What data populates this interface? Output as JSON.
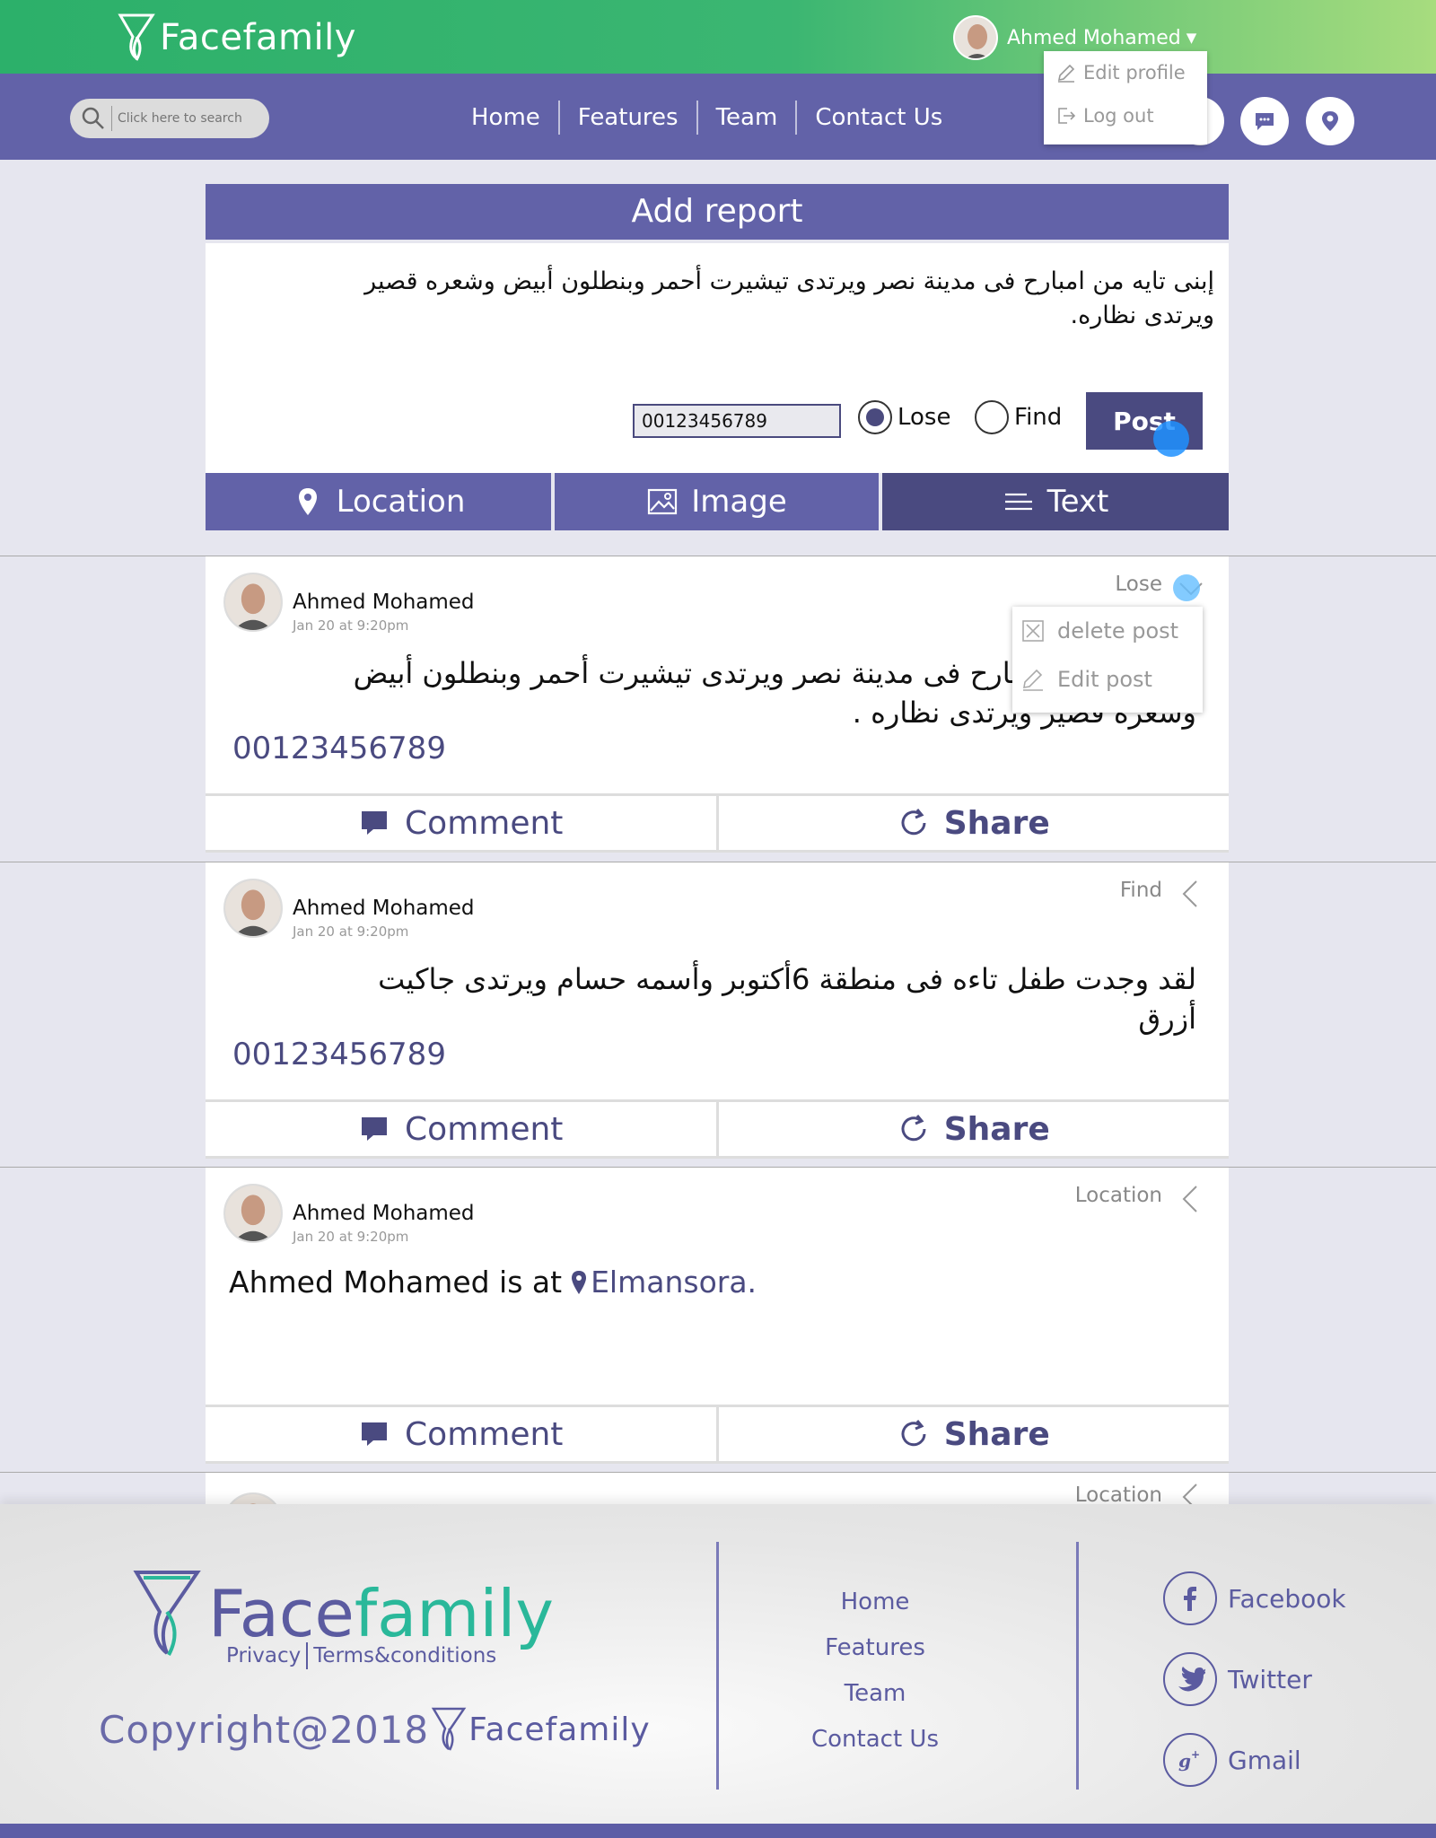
{
  "brand": {
    "name_part1": "Face",
    "name_part2": "family"
  },
  "user": {
    "name": "Ahmed Mohamed"
  },
  "user_dropdown": {
    "items": [
      {
        "label": "Edit profile",
        "icon": "pencil-icon"
      },
      {
        "label": "Log out",
        "icon": "logout-icon"
      }
    ]
  },
  "search": {
    "placeholder": "Click here to search"
  },
  "nav": {
    "links": [
      "Home",
      "Features",
      "Team",
      "Contact Us"
    ]
  },
  "report": {
    "title": "Add report",
    "text": "إبنى تايه من امبارح فى مدينة نصر ويرتدى تيشيرت أحمر وبنطلون أبيض وشعره قصير ويرتدى نظاره.",
    "phone": "00123456789",
    "option_lose": "Lose",
    "option_find": "Find",
    "selected": "Lose",
    "post_label": "Post",
    "tabs": [
      {
        "label": "Location",
        "icon": "map-pin-icon"
      },
      {
        "label": "Image",
        "icon": "image-icon"
      },
      {
        "label": "Text",
        "icon": "text-lines-icon",
        "active": true
      }
    ]
  },
  "posts": [
    {
      "author": "Ahmed Mohamed",
      "date": "Jan 20 at 9:20pm",
      "type": "Lose",
      "text": "إبنى تايه من امبارح فى مدينة نصر ويرتدى تيشيرت أحمر وبنطلون أبيض وشعره قصير ويرتدى نظاره .",
      "phone": "00123456789",
      "comment": "Comment",
      "share": "Share"
    },
    {
      "author": "Ahmed Mohamed",
      "date": "Jan 20 at 9:20pm",
      "type": "Find",
      "text": "لقد وجدت طفل تاءه فى منطقة 6أكتوبر وأسمه حسام ويرتدى جاكيت أزرق",
      "phone": "00123456789",
      "comment": "Comment",
      "share": "Share"
    },
    {
      "author": "Ahmed Mohamed",
      "date": "Jan 20 at 9:20pm",
      "type": "Location",
      "location_prefix": "Ahmed Mohamed is at",
      "location_place": "Elmansora.",
      "comment": "Comment",
      "share": "Share"
    },
    {
      "type": "Location"
    }
  ],
  "post_menu": {
    "items": [
      {
        "label": "delete post",
        "icon": "delete-box-icon"
      },
      {
        "label": "Edit post",
        "icon": "pencil-icon"
      }
    ]
  },
  "footer": {
    "legal_privacy": "Privacy",
    "legal_terms": "Terms&conditions",
    "copyright": "Copyright@2018",
    "links": [
      "Home",
      "Features",
      "Team",
      "Contact Us"
    ],
    "social": [
      {
        "label": "Facebook",
        "icon": "facebook-icon"
      },
      {
        "label": "Twitter",
        "icon": "twitter-icon"
      },
      {
        "label": "Gmail",
        "icon": "google-plus-icon"
      }
    ]
  },
  "colors": {
    "green": "#2cb06a",
    "purple": "#6262a8",
    "dark_purple": "#4a4a80",
    "teal": "#2ab89a"
  }
}
